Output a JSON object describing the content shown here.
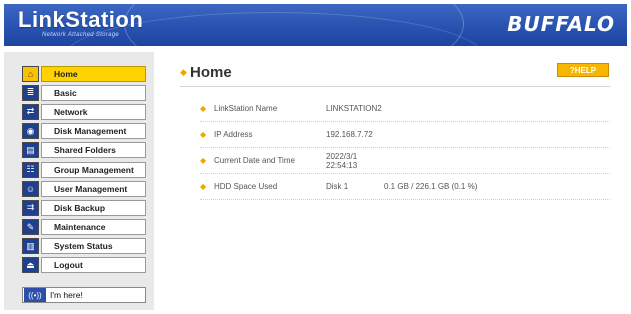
{
  "header": {
    "logo": "LinkStation",
    "logo_sub": "Network Attached Storage",
    "brand": "BUFFALO"
  },
  "sidebar": {
    "items": [
      {
        "label": "Home",
        "icon": "home-icon",
        "glyph": "⌂",
        "active": true
      },
      {
        "label": "Basic",
        "icon": "basic-icon",
        "glyph": "≣",
        "active": false
      },
      {
        "label": "Network",
        "icon": "network-icon",
        "glyph": "⇄",
        "active": false
      },
      {
        "label": "Disk Management",
        "icon": "disk-icon",
        "glyph": "◉",
        "active": false
      },
      {
        "label": "Shared Folders",
        "icon": "folder-icon",
        "glyph": "▤",
        "active": false
      },
      {
        "label": "Group Management",
        "icon": "group-icon",
        "glyph": "☷",
        "active": false
      },
      {
        "label": "User Management",
        "icon": "user-icon",
        "glyph": "☺",
        "active": false
      },
      {
        "label": "Disk Backup",
        "icon": "backup-icon",
        "glyph": "⇉",
        "active": false
      },
      {
        "label": "Maintenance",
        "icon": "maintenance-icon",
        "glyph": "✎",
        "active": false
      },
      {
        "label": "System Status",
        "icon": "status-icon",
        "glyph": "▥",
        "active": false
      },
      {
        "label": "Logout",
        "icon": "logout-icon",
        "glyph": "⏏",
        "active": false
      }
    ],
    "here_button": {
      "label": "I'm here!",
      "icon": "signal-icon",
      "glyph": "((•))"
    }
  },
  "main": {
    "title": "Home",
    "help_label": "?HELP",
    "rows": [
      {
        "label": "LinkStation Name",
        "value": "LINKSTATION2",
        "value2": ""
      },
      {
        "label": "IP Address",
        "value": "192.168.7.72",
        "value2": ""
      },
      {
        "label": "Current Date and Time",
        "value": "2022/3/1 22:54:13",
        "value2": ""
      },
      {
        "label": "HDD Space Used",
        "value": "Disk 1",
        "value2": "0.1 GB / 226.1 GB (0.1 %)"
      }
    ]
  },
  "colors": {
    "header_blue": "#2b56b4",
    "active_yellow": "#ffd200",
    "help_orange": "#f7b600",
    "bullet": "#f0a800"
  }
}
